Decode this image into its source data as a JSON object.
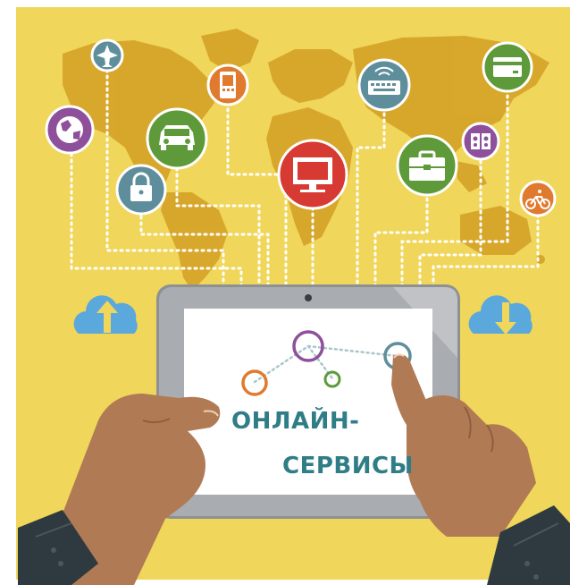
{
  "screen": {
    "title_line_1": "ОНЛАЙН-",
    "title_line_2": "СЕРВИСЫ"
  },
  "colors": {
    "background": "#f0d65a",
    "map": "#d6a52a",
    "tablet_frame": "#a9acb0",
    "screen": "#ffffff",
    "title_text": "#2f7d86",
    "skin": "#b07a55",
    "suit": "#2e3a3f",
    "cloud": "#5aa8dc"
  },
  "icons": [
    {
      "name": "airplane-icon",
      "color": "#5e8e9c"
    },
    {
      "name": "globe-icon",
      "color": "#8e4f9b"
    },
    {
      "name": "car-icon",
      "color": "#5e9a3a"
    },
    {
      "name": "mobile-phone-icon",
      "color": "#e07a2e"
    },
    {
      "name": "lock-icon",
      "color": "#5e8e9c"
    },
    {
      "name": "keyboard-icon",
      "color": "#5e8e9c"
    },
    {
      "name": "monitor-icon",
      "color": "#d63a33"
    },
    {
      "name": "briefcase-icon",
      "color": "#5e9a3a"
    },
    {
      "name": "credit-card-icon",
      "color": "#5e9a3a"
    },
    {
      "name": "speakers-icon",
      "color": "#8e4f9b"
    },
    {
      "name": "bicycle-icon",
      "color": "#e07a2e"
    },
    {
      "name": "cloud-upload-icon",
      "color": "#5aa8dc"
    },
    {
      "name": "cloud-download-icon",
      "color": "#5aa8dc"
    }
  ]
}
